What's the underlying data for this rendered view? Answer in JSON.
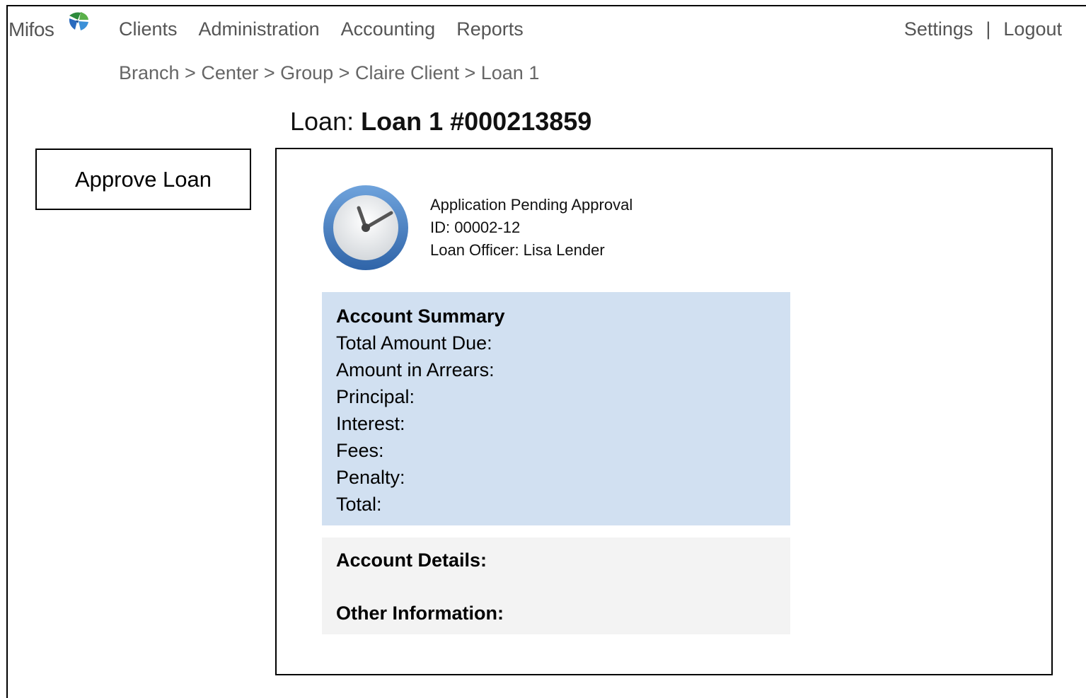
{
  "brand": {
    "name": "Mifos"
  },
  "nav": {
    "items": [
      {
        "label": "Clients"
      },
      {
        "label": "Administration"
      },
      {
        "label": "Accounting"
      },
      {
        "label": "Reports"
      }
    ],
    "settings": "Settings",
    "separator": "|",
    "logout": "Logout"
  },
  "breadcrumb": "Branch > Center > Group  > Claire Client > Loan 1",
  "page_title": {
    "prefix": "Loan: ",
    "name": "Loan 1 #000213859"
  },
  "actions": {
    "approve_label": "Approve Loan"
  },
  "loan_status": {
    "status": "Application Pending Approval",
    "id": "ID: 00002-12",
    "officer": "Loan Officer: Lisa Lender"
  },
  "summary": {
    "heading": "Account Summary",
    "rows": [
      "Total Amount Due:",
      "Amount in Arrears:",
      "Principal:",
      "Interest:",
      "Fees:",
      "Penalty:",
      "Total:"
    ]
  },
  "details": {
    "account_details": "Account Details:",
    "other_information": "Other Information:"
  },
  "colors": {
    "summary_bg": "#d1e0f1",
    "details_bg": "#f3f3f3",
    "clock_ring": "#4a80c0"
  },
  "icons": {
    "logo": "mifos-globe-icon",
    "status": "clock-icon"
  }
}
